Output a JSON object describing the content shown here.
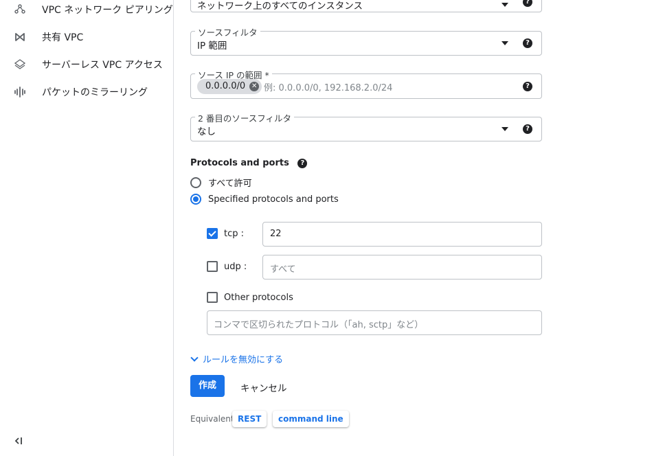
{
  "sidebar": {
    "items": [
      {
        "icon": "vpc-peering-icon",
        "label": "VPC ネットワーク ピアリング"
      },
      {
        "icon": "shared-vpc-icon",
        "label": "共有 VPC"
      },
      {
        "icon": "serverless-vpc-access-icon",
        "label": "サーバーレス VPC アクセス"
      },
      {
        "icon": "packet-mirroring-icon",
        "label": "パケットのミラーリング"
      }
    ],
    "collapse_icon": "collapse-sidebar-icon"
  },
  "form": {
    "targets": {
      "value": "ネットワーク上のすべてのインスタンス"
    },
    "source_filter": {
      "label": "ソースフィルタ",
      "value": "IP 範囲"
    },
    "source_ip": {
      "label": "ソース IP の範囲 *",
      "chip": "0.0.0.0/0",
      "placeholder": "例: 0.0.0.0/0, 192.168.2.0/24"
    },
    "second_filter": {
      "label": "2 番目のソースフィルタ",
      "value": "なし"
    },
    "protocols": {
      "title": "Protocols and ports",
      "allow_all": "すべて許可",
      "specified": "Specified protocols and ports",
      "selected": "specified",
      "tcp": {
        "label": "tcp :",
        "checked": true,
        "value": "22"
      },
      "udp": {
        "label": "udp :",
        "checked": false,
        "placeholder": "すべて"
      },
      "other": {
        "label": "Other protocols",
        "checked": false,
        "placeholder": "コンマで区切られたプロトコル（「ah, sctp」など）"
      }
    },
    "disable_rule_link": "ルールを無効にする",
    "create_button": "作成",
    "cancel_button": "キャンセル",
    "equivalent": {
      "label": "Equivalent:",
      "rest": "REST",
      "cli": "command line"
    }
  },
  "colors": {
    "accent": "#1a73e8",
    "border": "#bdc1c6",
    "chip": "#dadce0"
  }
}
